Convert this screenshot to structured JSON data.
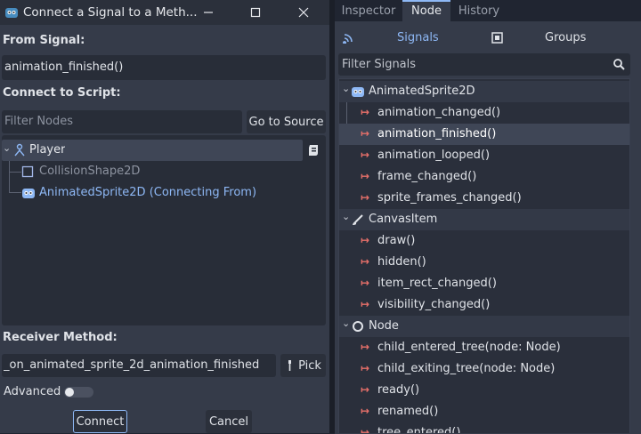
{
  "dialog": {
    "title": "Connect a Signal to a Meth...",
    "from_signal_label": "From Signal:",
    "from_signal_value": "animation_finished()",
    "connect_to_script_label": "Connect to Script:",
    "filter_nodes_placeholder": "Filter Nodes",
    "go_to_source_label": "Go to Source",
    "tree": [
      {
        "label": "Player",
        "icon": "player-node-icon"
      },
      {
        "label": "CollisionShape2D",
        "icon": "collision-shape-icon"
      },
      {
        "label": "AnimatedSprite2D (Connecting From)",
        "icon": "godot-sprite-icon"
      }
    ],
    "receiver_method_label": "Receiver Method:",
    "receiver_method_value": "_on_animated_sprite_2d_animation_finished",
    "pick_label": "Pick",
    "advanced_label": "Advanced",
    "connect_label": "Connect",
    "cancel_label": "Cancel"
  },
  "dock": {
    "tabs": [
      "Inspector",
      "Node",
      "History"
    ],
    "active_tab": "Node",
    "signals_label": "Signals",
    "groups_label": "Groups",
    "filter_signals_placeholder": "Filter Signals",
    "groups": [
      {
        "name": "AnimatedSprite2D",
        "icon": "godot-sprite-icon",
        "signals": [
          "animation_changed()",
          "animation_finished()",
          "animation_looped()",
          "frame_changed()",
          "sprite_frames_changed()"
        ]
      },
      {
        "name": "CanvasItem",
        "icon": "brush-icon",
        "signals": [
          "draw()",
          "hidden()",
          "item_rect_changed()",
          "visibility_changed()"
        ]
      },
      {
        "name": "Node",
        "icon": "node-circle-icon",
        "signals": [
          "child_entered_tree(node: Node)",
          "child_exiting_tree(node: Node)",
          "ready()",
          "renamed()",
          "tree_entered()"
        ]
      }
    ]
  },
  "colors": {
    "accent": "#8eb8f5",
    "signal_arrow": "#e8706a",
    "selected_row": "#3f4656",
    "dialog_bg": "#353b49"
  }
}
